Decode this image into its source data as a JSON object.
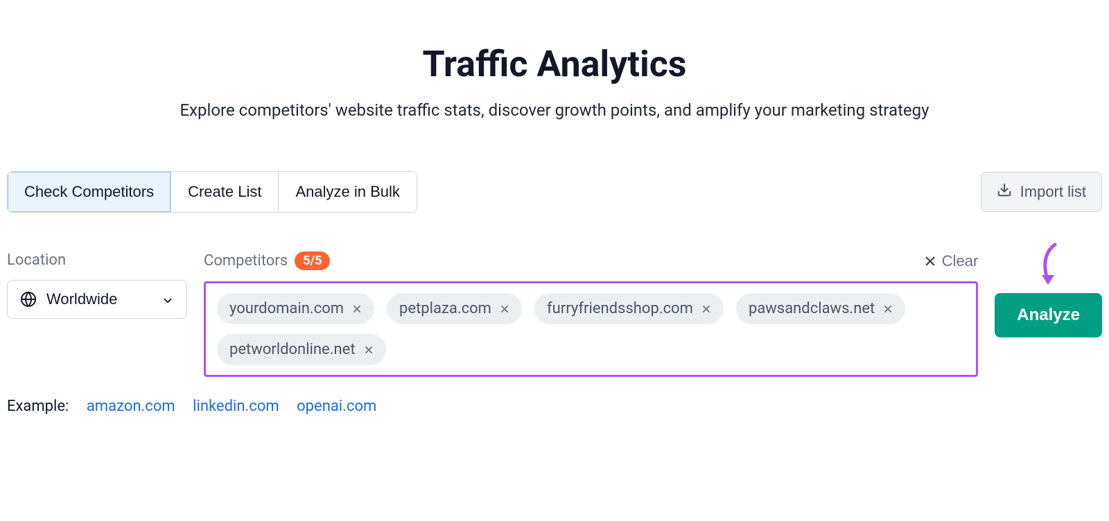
{
  "header": {
    "title": "Traffic Analytics",
    "subtitle": "Explore competitors' website traffic stats, discover growth points, and amplify your marketing strategy"
  },
  "tabs": [
    {
      "label": "Check Competitors",
      "active": true
    },
    {
      "label": "Create List",
      "active": false
    },
    {
      "label": "Analyze in Bulk",
      "active": false
    }
  ],
  "import_button": "Import list",
  "location": {
    "label": "Location",
    "value": "Worldwide"
  },
  "competitors": {
    "label": "Competitors",
    "badge": "5/5",
    "clear_label": "Clear",
    "chips": [
      "yourdomain.com",
      "petplaza.com",
      "furryfriendsshop.com",
      "pawsandclaws.net",
      "petworldonline.net"
    ]
  },
  "analyze_button": "Analyze",
  "example": {
    "label": "Example:",
    "links": [
      "amazon.com",
      "linkedin.com",
      "openai.com"
    ]
  },
  "colors": {
    "accent_green": "#009f81",
    "badge_orange": "#ff642d",
    "highlight_purple": "#a855f7",
    "link_blue": "#1b6be3",
    "tab_active_bg": "#e9f4ff"
  }
}
